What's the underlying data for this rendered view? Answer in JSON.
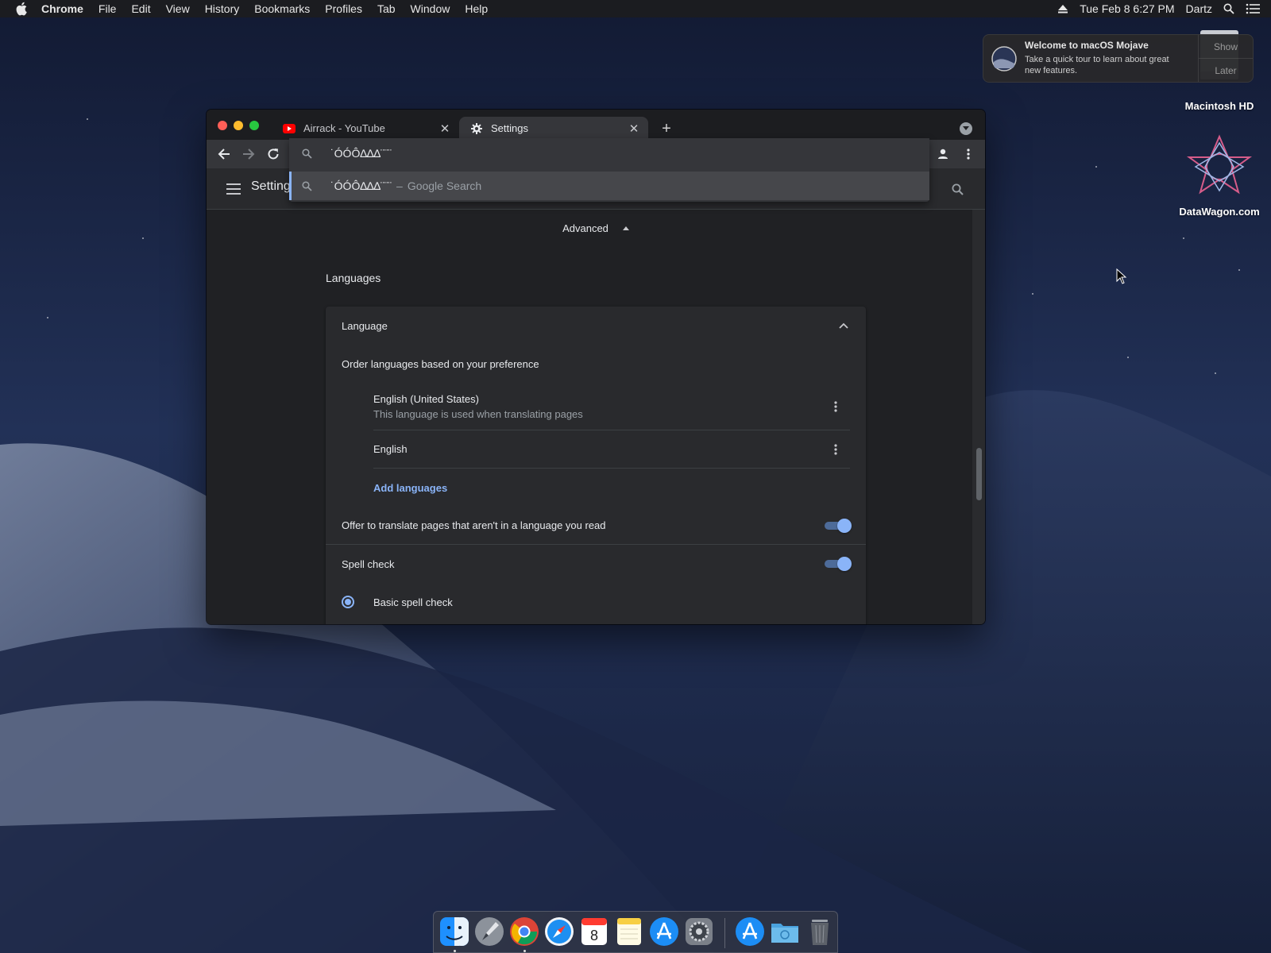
{
  "menubar": {
    "app_name": "Chrome",
    "items": [
      "File",
      "Edit",
      "View",
      "History",
      "Bookmarks",
      "Profiles",
      "Tab",
      "Window",
      "Help"
    ],
    "datetime": "Tue Feb 8  6:27 PM",
    "user": "Dartz"
  },
  "notification": {
    "title": "Welcome to macOS Mojave",
    "text": "Take a quick tour to learn about great new features.",
    "show_label": "Show",
    "later_label": "Later"
  },
  "desktop": {
    "hd_label": "Macintosh HD",
    "datawagon_label": "DataWagon.com"
  },
  "chrome": {
    "tabs": [
      {
        "label": "Airrack - YouTube",
        "icon": "youtube-icon"
      },
      {
        "label": "Settings",
        "icon": "gear-icon"
      }
    ],
    "omnibox": {
      "value": "˙ÓÓÔ∆∆∆¨¨¨",
      "suggestion_text": "˙ÓÓÔ∆∆∆¨¨¨",
      "suggestion_separator": "–",
      "suggestion_engine": "Google Search"
    },
    "settings": {
      "header_title": "Settings",
      "advanced_label": "Advanced",
      "section_title": "Languages",
      "language_header": "Language",
      "order_label": "Order languages based on your preference",
      "languages": [
        {
          "name": "English (United States)",
          "note": "This language is used when translating pages"
        },
        {
          "name": "English",
          "note": ""
        }
      ],
      "add_languages_label": "Add languages",
      "translate_label": "Offer to translate pages that aren't in a language you read",
      "translate_on": true,
      "spell_check_label": "Spell check",
      "spell_check_on": true,
      "basic_spell_label": "Basic spell check"
    }
  },
  "colors": {
    "accent": "#8ab4f8",
    "window_bg": "#202124",
    "card_bg": "#292a2d"
  }
}
